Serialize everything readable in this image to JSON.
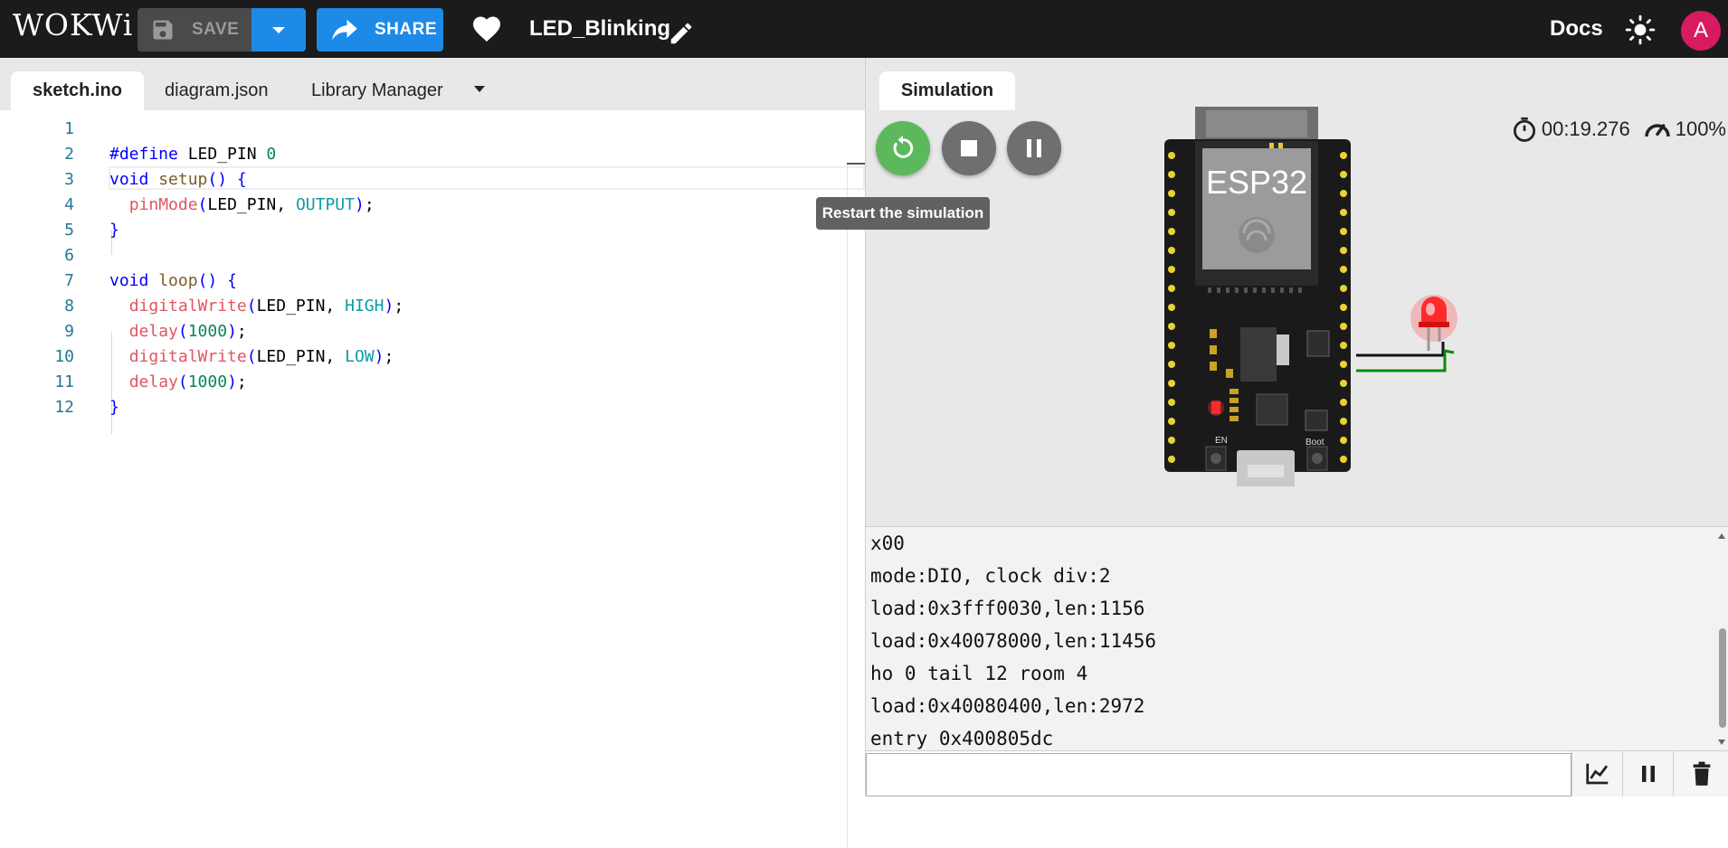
{
  "topbar": {
    "logo": "WOKWi",
    "save_label": "SAVE",
    "share_label": "SHARE",
    "project_name": "LED_Blinking",
    "docs_label": "Docs",
    "avatar_letter": "A"
  },
  "editor": {
    "tabs": [
      "sketch.ino",
      "diagram.json",
      "Library Manager"
    ],
    "active_tab": "sketch.ino",
    "line_numbers": [
      "1",
      "2",
      "3",
      "4",
      "5",
      "6",
      "7",
      "8",
      "9",
      "10",
      "11",
      "12"
    ]
  },
  "simulation": {
    "tab_label": "Simulation",
    "tooltip": "Restart the simulation",
    "timer": "00:19.276",
    "speed": "100%",
    "board_label": "ESP32",
    "led_color": "#ff2a2a"
  },
  "serial": {
    "lines": [
      "x00",
      "mode:DIO, clock div:2",
      "load:0x3fff0030,len:1156",
      "load:0x40078000,len:11456",
      "ho 0 tail 12 room 4",
      "load:0x40080400,len:2972",
      "entry 0x400805dc"
    ],
    "input_value": ""
  },
  "colors": {
    "topbar_bg": "#1b1b1b",
    "accent_blue": "#1e8ae8",
    "restart_green": "#5cb85c",
    "avatar_pink": "#d81b60"
  }
}
